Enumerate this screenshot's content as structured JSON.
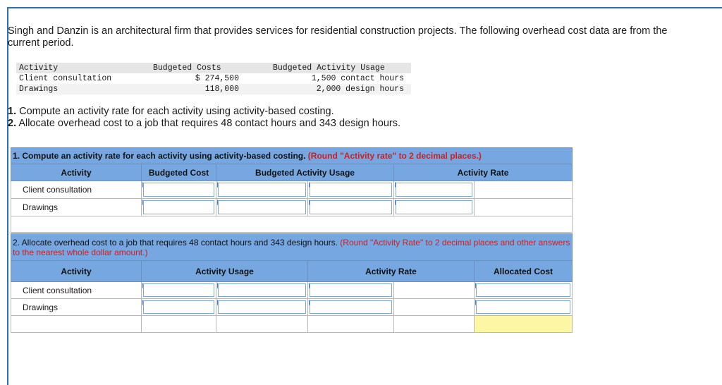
{
  "intro": "Singh and Danzin is an architectural firm that provides services for residential construction projects. The following overhead cost data are from the current period.",
  "given": {
    "headers": [
      "Activity",
      "Budgeted Costs",
      "Budgeted Activity Usage"
    ],
    "rows": [
      [
        "Client consultation",
        "$ 274,500",
        "1,500 contact hours"
      ],
      [
        "Drawings",
        "118,000",
        "2,000 design hours"
      ]
    ]
  },
  "requirements": [
    {
      "num": "1.",
      "text": " Compute an activity rate for each activity using activity-based costing."
    },
    {
      "num": "2.",
      "text": " Allocate overhead cost to a job that requires 48 contact hours and 343 design hours."
    }
  ],
  "part1": {
    "title": "1. Compute an activity rate for each activity using activity-based costing.",
    "note": " (Round \"Activity rate\" to 2 decimal places.)",
    "headers": [
      "Activity",
      "Budgeted Cost",
      "Budgeted Activity Usage",
      "Activity Rate"
    ],
    "rows": [
      "Client consultation",
      "Drawings"
    ]
  },
  "part2": {
    "title": "2. Allocate overhead cost to a job that requires 48 contact hours and 343 design hours.",
    "note": " (Round \"Activity Rate\" to 2 decimal places and other answers to the nearest whole dollar amount.)",
    "headers": [
      "Activity",
      "Activity Usage",
      "Activity Rate",
      "Allocated Cost"
    ],
    "rows": [
      "Client consultation",
      "Drawings"
    ]
  },
  "colors": {
    "header_blue": "#77a7e0",
    "note_red": "#cc1f1f",
    "total_yellow": "#fdf7a5",
    "border_blue": "#2f6fb6"
  }
}
